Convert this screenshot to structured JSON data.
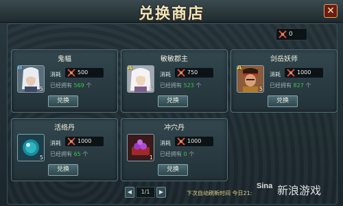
{
  "shop": {
    "title": "兑换商店",
    "close_glyph": "✕",
    "currency_value": "0",
    "items": [
      {
        "name": "鬼幅",
        "grade": "B",
        "stack": "5",
        "cost_label": "消耗",
        "cost": "500",
        "own_label": "已经拥有",
        "own_value": "569",
        "own_unit": "个",
        "button": "兑换"
      },
      {
        "name": "敏敏郡主",
        "grade": "A",
        "stack": "5",
        "cost_label": "消耗",
        "cost": "750",
        "own_label": "已经拥有",
        "own_value": "523",
        "own_unit": "个",
        "button": "兑换"
      },
      {
        "name": "剑岳妖师",
        "grade": "A",
        "stack": "5",
        "cost_label": "消耗",
        "cost": "1000",
        "own_label": "已经拥有",
        "own_value": "827",
        "own_unit": "个",
        "button": "兑换"
      },
      {
        "name": "活络丹",
        "grade": "",
        "stack": "5",
        "cost_label": "消耗",
        "cost": "1000",
        "own_label": "已经拥有",
        "own_value": "65",
        "own_unit": "个",
        "button": "兑换"
      },
      {
        "name": "冲穴丹",
        "grade": "",
        "stack": "1",
        "cost_label": "消耗",
        "cost": "1000",
        "own_label": "已经拥有",
        "own_value": "0",
        "own_unit": "个",
        "button": "兑换"
      }
    ],
    "pager": {
      "prev": "◀",
      "page": "1/1",
      "next": "▶"
    },
    "refresh_text": "下次自动刷新时间 今日21:"
  },
  "watermark": {
    "logo": "Sina",
    "text": "新浪游戏"
  },
  "colors": {
    "own_value": "#42c34a",
    "title": "#f2e5c0"
  }
}
